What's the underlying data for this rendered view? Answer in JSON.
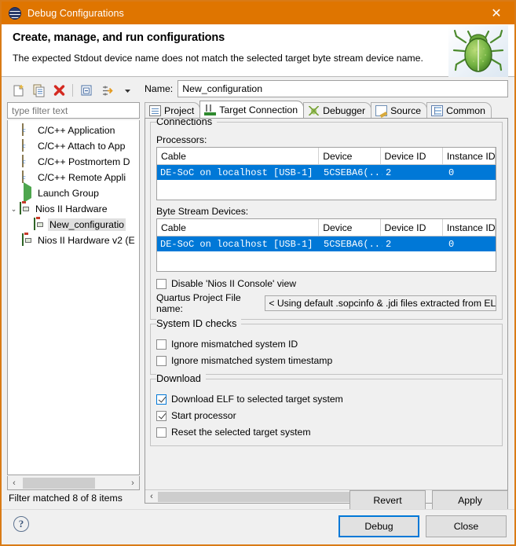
{
  "window": {
    "title": "Debug Configurations",
    "icon": "debug-config-icon",
    "close_label": "✕",
    "accent_color": "#df7500"
  },
  "header": {
    "title": "Create, manage, and run configurations",
    "message": "The expected Stdout device name does not match the selected target byte stream device name.",
    "icon": "green-bug-icon"
  },
  "left_panel": {
    "toolbar": [
      {
        "name": "new-launch-configuration-icon",
        "title": "New launch configuration"
      },
      {
        "name": "duplicate-configuration-icon",
        "title": "Duplicate"
      },
      {
        "name": "delete-configuration-icon",
        "title": "Delete"
      },
      {
        "name": "collapse-all-icon",
        "title": "Collapse All"
      },
      {
        "name": "filter-launch-configurations-icon",
        "title": "Filter"
      },
      {
        "name": "view-menu-chevron-down-icon",
        "title": "View Menu"
      }
    ],
    "filter": {
      "placeholder": "type filter text",
      "value": ""
    },
    "tree": [
      {
        "label": "C/C++ Application",
        "icon": "cpp-icon",
        "indent": 1,
        "twist": "",
        "selected": false
      },
      {
        "label": "C/C++ Attach to App",
        "icon": "cpp-icon",
        "indent": 1,
        "twist": "",
        "selected": false
      },
      {
        "label": "C/C++ Postmortem D",
        "icon": "cpp-icon",
        "indent": 1,
        "twist": "",
        "selected": false
      },
      {
        "label": "C/C++ Remote Appli",
        "icon": "cpp-icon",
        "indent": 1,
        "twist": "",
        "selected": false
      },
      {
        "label": "Launch Group",
        "icon": "launch-group-icon",
        "indent": 1,
        "twist": "",
        "selected": false
      },
      {
        "label": "Nios II Hardware",
        "icon": "nios-icon",
        "indent": 0,
        "twist": "⌄",
        "selected": false
      },
      {
        "label": "New_configuratio",
        "icon": "nios-icon",
        "indent": 2,
        "twist": "",
        "selected": true
      },
      {
        "label": "Nios II Hardware v2 (E",
        "icon": "nios-icon",
        "indent": 1,
        "twist": "",
        "selected": false
      }
    ],
    "scroll": {
      "left_arrow": "‹",
      "right_arrow": "›"
    },
    "status": "Filter matched 8 of 8 items"
  },
  "config": {
    "name_label": "Name:",
    "name_value": "New_configuration",
    "tabs": [
      {
        "label": "Project",
        "icon": "project-doc-icon",
        "active": false
      },
      {
        "label": "Target Connection",
        "icon": "target-connection-icon",
        "active": true
      },
      {
        "label": "Debugger",
        "icon": "debugger-icon",
        "active": false
      },
      {
        "label": "Source",
        "icon": "source-icon",
        "active": false
      },
      {
        "label": "Common",
        "icon": "common-icon",
        "active": false
      }
    ],
    "connections": {
      "legend": "Connections",
      "processors_label": "Processors:",
      "byte_stream_label": "Byte Stream Devices:",
      "columns": [
        "Cable",
        "Device",
        "Device ID",
        "Instance ID"
      ],
      "processors_rows": [
        {
          "cable": "DE-SoC on localhost [USB-1]",
          "device": "5CSEBA6(...",
          "device_id": "2",
          "instance_id": "0",
          "selected": true
        }
      ],
      "byte_stream_rows": [
        {
          "cable": "DE-SoC on localhost [USB-1]",
          "device": "5CSEBA6(...",
          "device_id": "2",
          "instance_id": "0",
          "selected": true
        }
      ],
      "disable_console": {
        "label": "Disable 'Nios II Console' view",
        "checked": false,
        "focused": false
      },
      "quartus_label": "Quartus Project File name:",
      "quartus_value": "< Using default .sopcinfo & .jdi files extracted from ELF >"
    },
    "system_id_checks": {
      "legend": "System ID checks",
      "items": [
        {
          "label": "Ignore mismatched system ID",
          "checked": false,
          "focused": false
        },
        {
          "label": "Ignore mismatched system timestamp",
          "checked": false,
          "focused": false
        }
      ]
    },
    "download": {
      "legend": "Download",
      "items": [
        {
          "label": "Download ELF to selected target system",
          "checked": true,
          "focused": true
        },
        {
          "label": "Start processor",
          "checked": true,
          "focused": false
        },
        {
          "label": "Reset the selected target system",
          "checked": false,
          "focused": false
        }
      ]
    },
    "panel_scroll": {
      "left_arrow": "‹",
      "right_arrow": "›"
    }
  },
  "actions": {
    "revert": "Revert",
    "apply": "Apply",
    "debug": "Debug",
    "close": "Close",
    "help": "?",
    "default_button_color": "#0078d7"
  }
}
